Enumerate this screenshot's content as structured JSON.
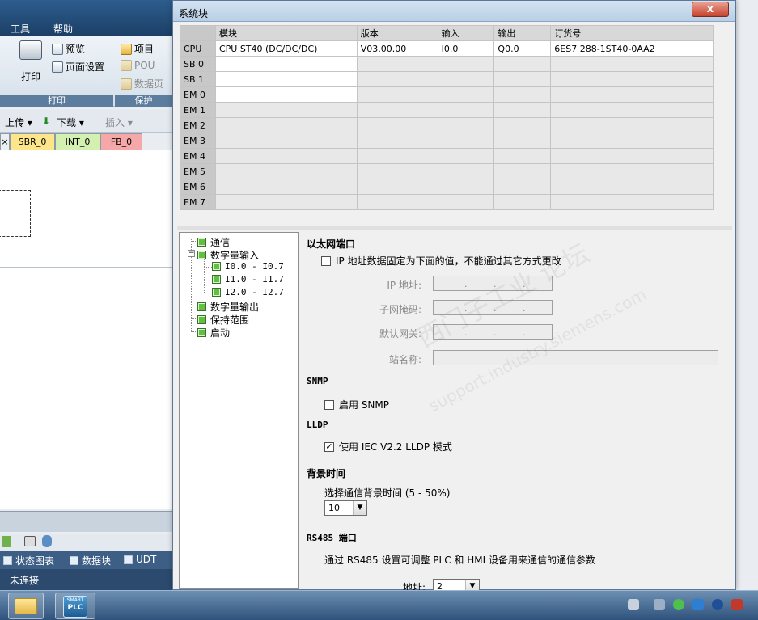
{
  "menubar": {
    "items": [
      "工具",
      "帮助"
    ]
  },
  "ribbon": {
    "print_label": "打印",
    "preview_label": "预览",
    "page_setup_label": "页面设置",
    "print_group_label": "打印",
    "project_label": "项目",
    "pou_label": "POU",
    "data_page_label": "数据页",
    "protect_group_label": "保护"
  },
  "toolbar2": {
    "upload_label": "上传",
    "download_label": "下载",
    "insert_label": "插入"
  },
  "editor_tabs": [
    "SBR_0",
    "INT_0",
    "FB_0"
  ],
  "bottom_tabs": {
    "status_chart": "状态图表",
    "data_block": "数据块",
    "udt": "UDT"
  },
  "status_bar": {
    "connection": "未连接"
  },
  "dialog": {
    "title": "系统块",
    "close_symbol": "x",
    "grid": {
      "headers": [
        "模块",
        "版本",
        "输入",
        "输出",
        "订货号"
      ],
      "rows": [
        {
          "slot": "CPU",
          "module": "CPU ST40 (DC/DC/DC)",
          "version": "V03.00.00",
          "input": "I0.0",
          "output": "Q0.0",
          "order": "6ES7 288-1ST40-0AA2"
        },
        {
          "slot": "SB 0",
          "module": "",
          "version": "",
          "input": "",
          "output": "",
          "order": ""
        },
        {
          "slot": "SB 1",
          "module": "",
          "version": "",
          "input": "",
          "output": "",
          "order": ""
        },
        {
          "slot": "EM 0",
          "module": "",
          "version": "",
          "input": "",
          "output": "",
          "order": ""
        },
        {
          "slot": "EM 1",
          "module": "",
          "version": "",
          "input": "",
          "output": "",
          "order": ""
        },
        {
          "slot": "EM 2",
          "module": "",
          "version": "",
          "input": "",
          "output": "",
          "order": ""
        },
        {
          "slot": "EM 3",
          "module": "",
          "version": "",
          "input": "",
          "output": "",
          "order": ""
        },
        {
          "slot": "EM 4",
          "module": "",
          "version": "",
          "input": "",
          "output": "",
          "order": ""
        },
        {
          "slot": "EM 5",
          "module": "",
          "version": "",
          "input": "",
          "output": "",
          "order": ""
        },
        {
          "slot": "EM 6",
          "module": "",
          "version": "",
          "input": "",
          "output": "",
          "order": ""
        },
        {
          "slot": "EM 7",
          "module": "",
          "version": "",
          "input": "",
          "output": "",
          "order": ""
        }
      ]
    },
    "tree": {
      "comm": "通信",
      "digital_input": "数字量输入",
      "di_0": "I0.0 - I0.7",
      "di_1": "I1.0 - I1.7",
      "di_2": "I2.0 - I2.7",
      "digital_output": "数字量输出",
      "retain": "保持范围",
      "startup": "启动"
    },
    "panel": {
      "ethernet_title": "以太网端口",
      "ip_fixed_label": "IP 地址数据固定为下面的值，不能通过其它方式更改",
      "ip_label": "IP 地址:",
      "subnet_label": "子网掩码:",
      "gateway_label": "默认网关:",
      "station_label": "站名称:",
      "snmp_title": "SNMP",
      "snmp_enable_label": "启用 SNMP",
      "lldp_title": "LLDP",
      "lldp_label": "使用 IEC V2.2 LLDP 模式",
      "lldp_checked": "✓",
      "bg_title": "背景时间",
      "bg_label": "选择通信背景时间 (5 - 50%)",
      "bg_value": "10",
      "rs485_title": "RS485 端口",
      "rs485_desc": "通过 RS485 设置可调整 PLC 和 HMI 设备用来通信的通信参数",
      "address_label": "地址:",
      "address_value": "2"
    },
    "watermark_cn": "西门子工业 论坛",
    "watermark_en": "support.industry.siemens.com"
  },
  "taskbar": {
    "plc_small": "SMART",
    "plc_large": "PLC"
  }
}
